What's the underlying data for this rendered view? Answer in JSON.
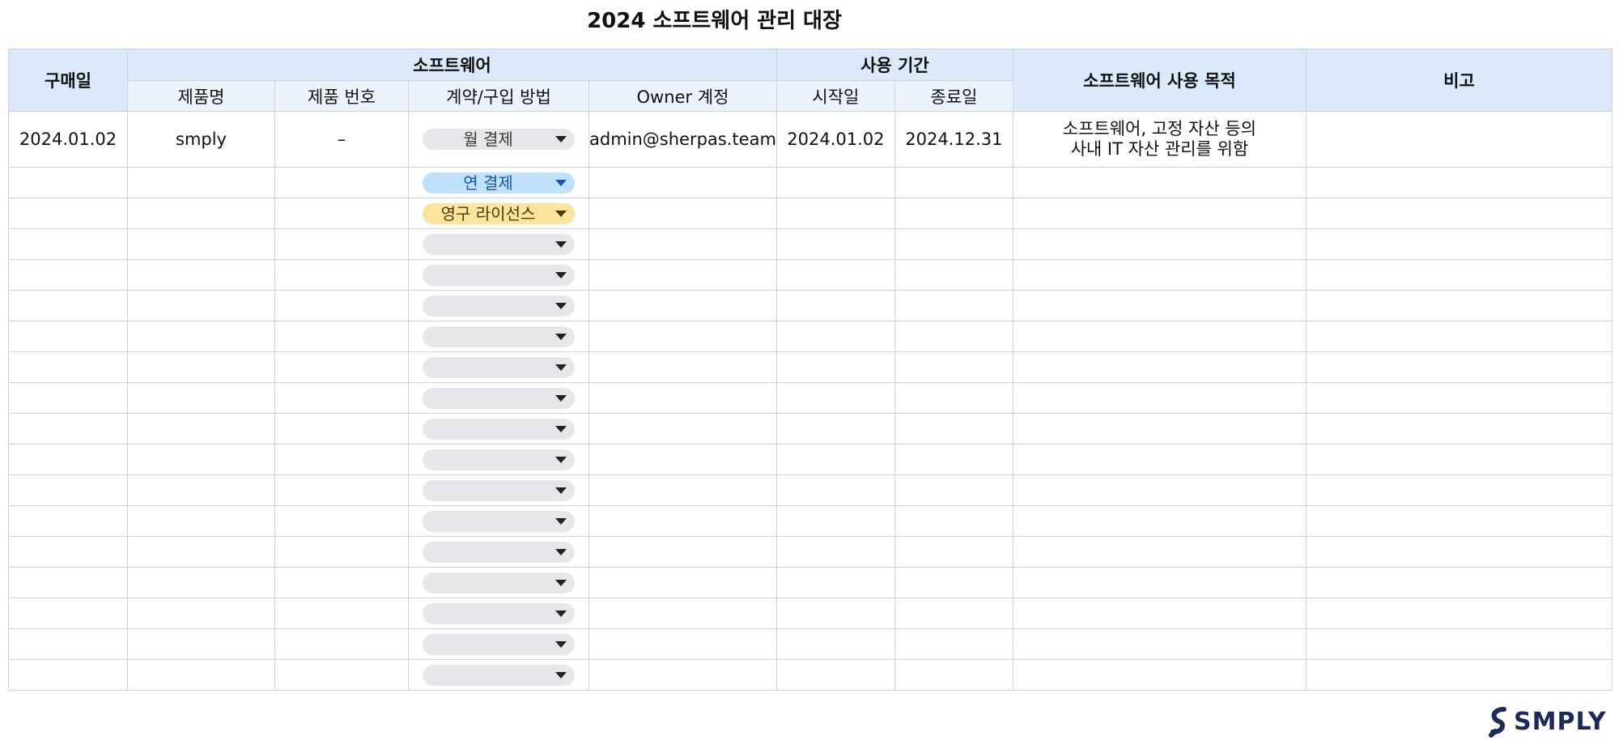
{
  "title": "2024 소프트웨어 관리 대장",
  "headers": {
    "purchase_date": "구매일",
    "software_group": "소프트웨어",
    "period_group": "사용 기간",
    "purpose": "소프트웨어 사용 목적",
    "note": "비고",
    "product_name": "제품명",
    "product_number": "제품 번호",
    "contract_method": "계약/구입 방법",
    "owner_account": "Owner 계정",
    "start_date": "시작일",
    "end_date": "종료일"
  },
  "first_row": {
    "purchase_date": "2024.01.02",
    "product_name": "smply",
    "product_number": "–",
    "contract_method": "월 결제",
    "owner_account": "admin@sherpas.team",
    "start_date": "2024.01.02",
    "end_date": "2024.12.31",
    "purpose_line1": "소프트웨어, 고정 자산 등의",
    "purpose_line2": "사내 IT 자산 관리를 위함",
    "note": ""
  },
  "dropdown_rows": [
    {
      "value": "연 결제",
      "color": "#bfe1fa"
    },
    {
      "value": "영구 라이선스",
      "color": "#fde49c"
    },
    {
      "value": ""
    },
    {
      "value": ""
    },
    {
      "value": ""
    },
    {
      "value": ""
    },
    {
      "value": ""
    },
    {
      "value": ""
    },
    {
      "value": ""
    },
    {
      "value": ""
    },
    {
      "value": ""
    },
    {
      "value": ""
    },
    {
      "value": ""
    },
    {
      "value": ""
    },
    {
      "value": ""
    },
    {
      "value": ""
    },
    {
      "value": ""
    }
  ],
  "chip_colors": {
    "default": "#e6e7ea",
    "blue": "#bfe1fa",
    "yellow": "#fde49c"
  },
  "header_colors": {
    "main": "#dce9fa",
    "sub": "#ebf2fc"
  },
  "logo": {
    "text": "SMPLY",
    "icon": "smply-logo-icon"
  }
}
